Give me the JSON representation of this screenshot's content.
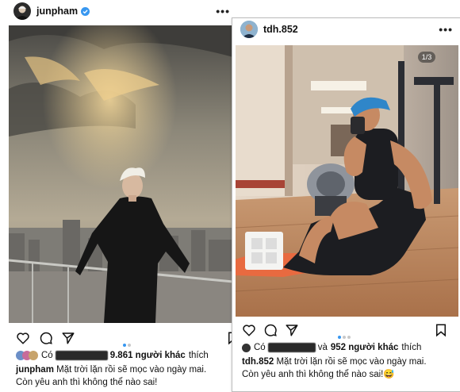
{
  "left_post": {
    "username": "junpham",
    "more_label": "•••",
    "likes_prefix": "Có",
    "likes_count": "9.861 người khác",
    "likes_suffix": "thích",
    "caption_user": "junpham",
    "caption_line1": "Mặt trời lặn rồi sẽ mọc vào ngày mai.",
    "caption_line2": "Còn yêu anh thì không thể nào sai!"
  },
  "right_post": {
    "username": "tdh.852",
    "more_label": "•••",
    "photo_counter": "1/3",
    "likes_prefix": "Có",
    "likes_and": "và",
    "likes_count": "952 người khác",
    "likes_suffix": "thích",
    "caption_user": "tdh.852",
    "caption_line1": "Mặt trời lặn rồi sẽ mọc vào ngày mai.",
    "caption_line2": "Còn yêu anh thì không thể nào sai!",
    "emoji": "😅"
  },
  "colors": {
    "verified": "#3897f0",
    "dot_active": "#3897f0",
    "dot_inactive": "#c8c8c8"
  },
  "icons": [
    "heart-icon",
    "comment-icon",
    "share-icon",
    "bookmark-icon",
    "verified-badge-icon",
    "more-icon"
  ]
}
